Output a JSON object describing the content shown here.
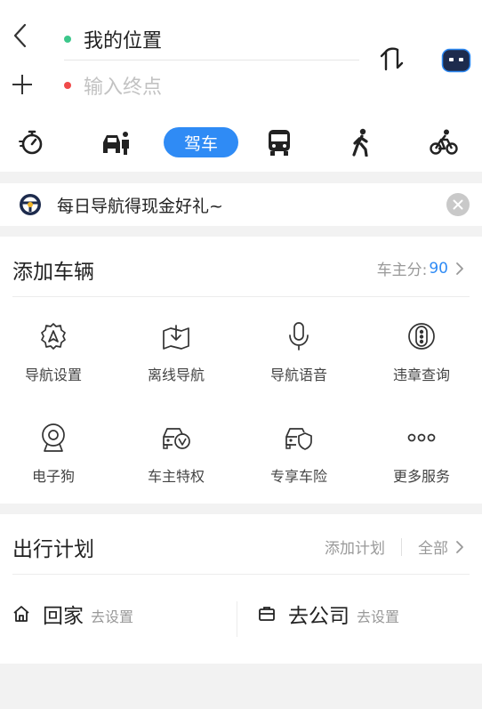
{
  "route": {
    "origin": "我的位置",
    "destination_placeholder": "输入终点",
    "origin_dot_color": "#3cc78b",
    "dest_dot_color": "#f04a4a"
  },
  "modes": [
    {
      "id": "timer",
      "icon": "timer-icon"
    },
    {
      "id": "ride-hailing",
      "icon": "car-hailing-icon"
    },
    {
      "id": "drive",
      "label": "驾车",
      "active": true
    },
    {
      "id": "bus",
      "icon": "bus-icon"
    },
    {
      "id": "walk",
      "icon": "walk-icon"
    },
    {
      "id": "bike",
      "icon": "bike-icon"
    }
  ],
  "promo": {
    "text": "每日导航得现金好礼~"
  },
  "vehicle": {
    "title": "添加车辆",
    "score_label": "车主分:",
    "score_value": "90",
    "services": [
      {
        "label": "导航设置",
        "icon": "navigation-settings-icon"
      },
      {
        "label": "离线导航",
        "icon": "offline-navigation-icon"
      },
      {
        "label": "导航语音",
        "icon": "microphone-icon"
      },
      {
        "label": "违章查询",
        "icon": "violation-query-icon"
      },
      {
        "label": "电子狗",
        "icon": "webcam-icon"
      },
      {
        "label": "车主特权",
        "icon": "car-privilege-icon"
      },
      {
        "label": "专享车险",
        "icon": "car-insurance-icon"
      },
      {
        "label": "更多服务",
        "icon": "more-icon"
      }
    ]
  },
  "plan": {
    "title": "出行计划",
    "add_label": "添加计划",
    "all_label": "全部",
    "home_label": "回家",
    "home_sub": "去设置",
    "work_label": "去公司",
    "work_sub": "去设置"
  },
  "colors": {
    "accent": "#2f8bf5",
    "background": "#f2f2f2"
  }
}
